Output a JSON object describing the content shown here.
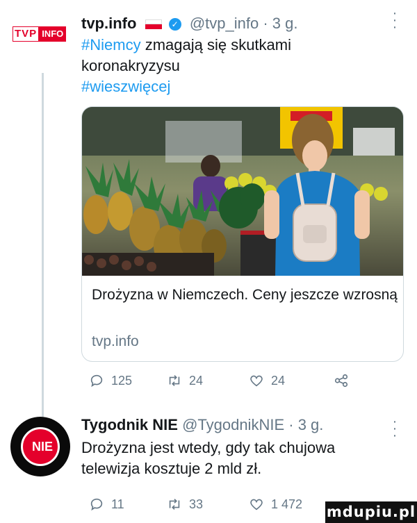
{
  "tweet1": {
    "author_name": "tvp.info",
    "handle": "@tvp_info",
    "time": "· 3 g.",
    "avatar_text_a": "TVP",
    "avatar_text_b": "INFO",
    "hashtag1": "#Niemcy",
    "text_part1": " zmagają się skutkami koronakryzysu",
    "hashtag2": "#wieszwięcej",
    "card": {
      "title": "Drożyzna w Niemczech. Ceny jeszcze wzrosną",
      "domain": "tvp.info"
    },
    "replies": "125",
    "retweets": "24",
    "likes": "24"
  },
  "tweet2": {
    "author_name": "Tygodnik NIE",
    "handle": "@TygodnikNIE",
    "time": "· 3 g.",
    "avatar_text": "NIE",
    "text": "Drożyzna jest wtedy, gdy tak chujowa telewizja kosztuje 2 mld zł.",
    "replies": "11",
    "retweets": "33",
    "likes": "1 472"
  },
  "watermark": "mdupiu.pl",
  "colors": {
    "accent": "#1d9bf0",
    "muted": "#657786",
    "brand_red": "#e4002b"
  },
  "icons": [
    "more-icon",
    "verified-icon",
    "flag-icon",
    "reply-icon",
    "retweet-icon",
    "like-icon",
    "share-icon"
  ]
}
